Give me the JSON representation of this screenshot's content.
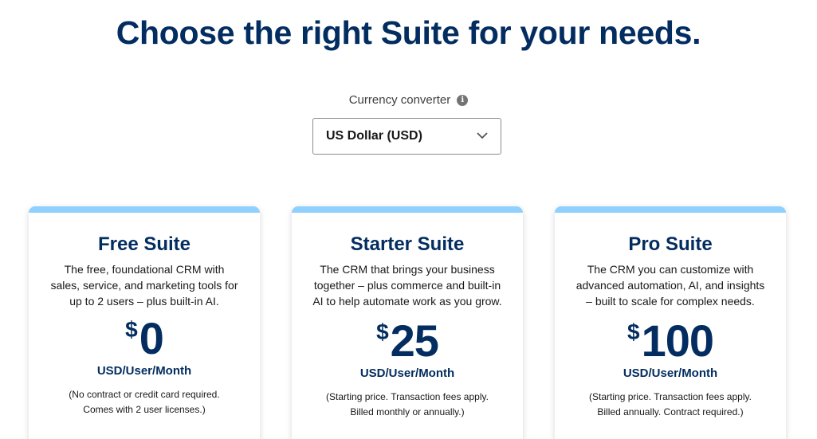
{
  "header": {
    "title": "Choose the right Suite for your needs."
  },
  "currency": {
    "label": "Currency converter",
    "info_glyph": "i",
    "selected": "US Dollar (USD)"
  },
  "plans": [
    {
      "name": "Free Suite",
      "description": "The free, foundational CRM with sales, service, and marketing tools for up to 2 users – plus built-in AI.",
      "currency_symbol": "$",
      "price": "0",
      "unit": "USD/User/Month",
      "note_lines": [
        "(No contract or credit card required.",
        "Comes with 2 user licenses.)"
      ]
    },
    {
      "name": "Starter Suite",
      "description": "The CRM that brings your business together – plus commerce and built-in AI to help automate work as you grow.",
      "currency_symbol": "$",
      "price": "25",
      "unit": "USD/User/Month",
      "note_lines": [
        "(Starting price. Transaction fees apply.",
        "Billed monthly or annually.)"
      ]
    },
    {
      "name": "Pro Suite",
      "description": "The CRM you can customize with advanced automation, AI, and insights – built to scale for complex needs.",
      "currency_symbol": "$",
      "price": "100",
      "unit": "USD/User/Month",
      "note_lines": [
        "(Starting price. Transaction fees apply.",
        "Billed annually. Contract required.)"
      ]
    }
  ],
  "colors": {
    "heading": "#032d60",
    "card_accent": "#90d0fe"
  },
  "icons": {
    "info": "info-icon",
    "dropdown": "chevron-down-icon"
  }
}
